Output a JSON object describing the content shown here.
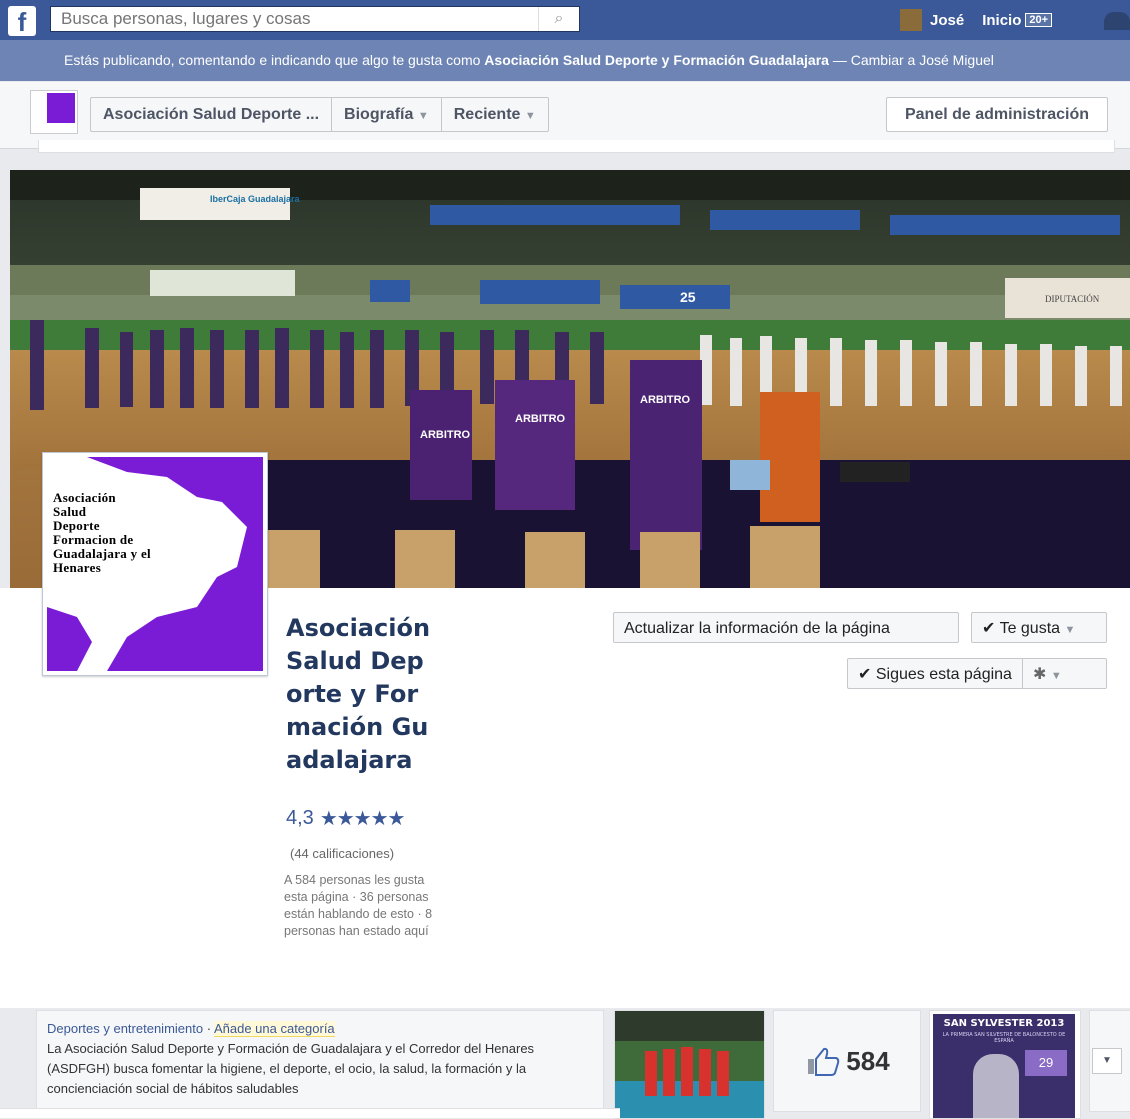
{
  "topbar": {
    "search_placeholder": "Busca personas, lugares y cosas",
    "user_name": "José",
    "home_label": "Inicio",
    "home_badge": "20+"
  },
  "notice": {
    "prefix": "Estás publicando, comentando e indicando que algo te gusta como ",
    "page": "Asociación Salud Deporte y Formación Guadalajara",
    "suffix": " — Cambiar a José Miguel"
  },
  "pagebar": {
    "page_tab": "Asociación Salud Deporte ...",
    "timeline_tab": "Biografía",
    "recent_tab": "Reciente",
    "admin_button": "Panel de administración"
  },
  "cover": {
    "ibercaja": "IberCaja Guadalajara",
    "diputacion": "DIPUTACIÓN",
    "arbitro": "ARBITRO",
    "number_25": "25"
  },
  "profile_pic": {
    "line1": "Asociación",
    "line2": "Salud",
    "line3": "Deporte",
    "line4": "Formacion de",
    "line5": "Guadalajara y el",
    "line6": "Henares"
  },
  "page": {
    "name": "Asociación Salud Deporte y Formación Guadalajara",
    "rating": "4,3",
    "stars": "★★★★★",
    "ratings_count": "(44 calificaciones)",
    "likes_summary": "A 584 personas les gusta esta página · 36 personas están hablando de esto · 8 personas han estado aquí"
  },
  "actions": {
    "update_info": "Actualizar la información de la página",
    "liked": "✔ Te gusta",
    "following": "✔ Sigues esta página"
  },
  "about": {
    "category": "Deportes y entretenimiento",
    "add_category": "Añade una categoría",
    "description": "La Asociación Salud Deporte y Formación de Guadalajara y el Corredor del Henares (ASDFGH) busca fomentar la higiene, el deporte, el ocio, la salud, la formación y la concienciación social de hábitos saludables"
  },
  "likes_box": {
    "count": "584"
  },
  "poster": {
    "title": "SAN SYLVESTER 2013",
    "subtitle": "LA PRIMERA SAN SILVESTRE DE BALONCESTO DE ESPAÑA",
    "day": "29"
  },
  "colors": {
    "facebook_blue": "#3b5998",
    "purple": "#7a1bd6"
  }
}
